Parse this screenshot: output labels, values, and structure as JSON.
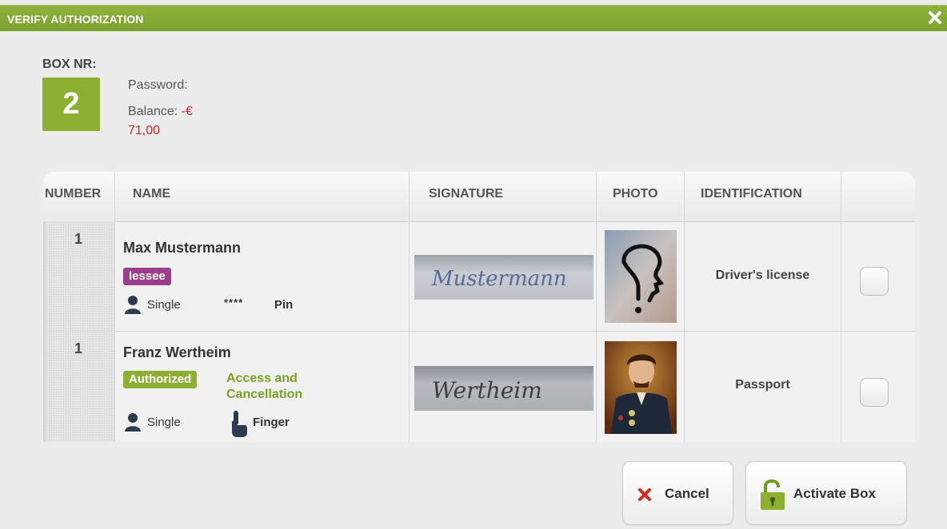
{
  "dialog": {
    "title": "VERIFY AUTHORIZATION",
    "accent_color": "#8db033"
  },
  "box": {
    "label": "BOX NR:",
    "number": "2",
    "password_label": "Password:",
    "balance_label": "Balance:",
    "balance_sign": "-€",
    "balance_amount": "71,00"
  },
  "table": {
    "headers": [
      "NUMBER",
      "NAME",
      "SIGNATURE",
      "PHOTO",
      "IDENTIFICATION",
      ""
    ],
    "rows": [
      {
        "number": "1",
        "name": "Max Mustermann",
        "role": "lessee",
        "role_color": "#9b3d8b",
        "rights": "",
        "type": "Single",
        "auth_icon": "pin-stars",
        "auth_mask": "****",
        "auth_method": "Pin",
        "signature_text": "Mustermann",
        "photo": "question-mark-head",
        "identification": "Driver's license",
        "checked": false
      },
      {
        "number": "1",
        "name": "Franz Wertheim",
        "role": "Authorized",
        "role_color": "#8db033",
        "rights_line1": "Access and",
        "rights_line2": "Cancellation",
        "type": "Single",
        "auth_icon": "finger-icon",
        "auth_method": "Finger",
        "signature_text": "Wertheim",
        "photo": "portrait",
        "identification": "Passport",
        "checked": false
      }
    ]
  },
  "buttons": {
    "cancel": "Cancel",
    "activate": "Activate Box"
  },
  "colors": {
    "negative": "#c92a2a",
    "rights_text": "#7a9f24"
  }
}
